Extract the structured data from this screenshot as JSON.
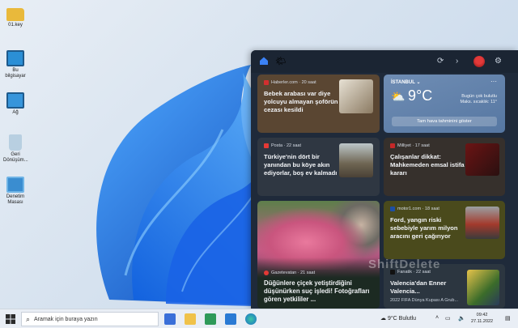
{
  "desktop": {
    "icons": [
      {
        "label": "01.key",
        "icon": "folder-icon",
        "color": "#e8b73a"
      },
      {
        "label": "Bu bilgisayar",
        "icon": "computer-icon",
        "color": "#2b8fd6"
      },
      {
        "label": "Ağ",
        "icon": "network-icon",
        "color": "#2b8fd6"
      },
      {
        "label": "Geri Dönüşüm...",
        "icon": "recycle-bin-icon",
        "color": "#7aa7c7"
      },
      {
        "label": "Denetim Masası",
        "icon": "control-panel-icon",
        "color": "#3a8dd0"
      }
    ]
  },
  "widgets": {
    "top_bar": {
      "home_icon": "home-icon",
      "weather_icon": "weather-icon",
      "refresh_icon": "refresh-icon",
      "next_icon": "chevron-right-icon",
      "settings_icon": "gear-icon"
    },
    "weather": {
      "city": "İSTANBUL",
      "temp": "9°C",
      "condition": "Bugün çok bulutlu",
      "max": "Maks. sıcaklık: 11°",
      "button": "Tam hava tahminini göster"
    },
    "cards": [
      {
        "source": "Haberler.com · 20 saat",
        "title": "Bebek arabası var diye yolcuyu almayan şoförün cezası kesildi",
        "favcolor": "#d32f2f"
      },
      {
        "source": "Posta · 22 saat",
        "title": "Türkiye'nin dört bir yanından bu köye akın ediyorlar, boş ev kalmadı",
        "favcolor": "#e53935"
      },
      {
        "source": "Milliyet · 17 saat",
        "title": "Çalışanlar dikkat: Mahkemeden emsal istifa kararı",
        "favcolor": "#c62828"
      },
      {
        "source": "Gazetevatan · 21 saat",
        "title": "Düğünlere çiçek yetiştirdiğini düşünürken suç işledi! Fotoğrafları gören yetkililer ...",
        "favcolor": "#e53935"
      },
      {
        "source": "motor1.com · 18 saat",
        "title": "Ford, yangın riski sebebiyle yarım milyon aracını geri çağırıyor",
        "favcolor": "#1e4fa3"
      },
      {
        "source": "Fanatik · 22 saat",
        "title": "Valencia'dan Enner Valencia...",
        "subtitle": "2022 FIFA Dünya Kupası A Grub...",
        "favcolor": "#1a1a1a"
      }
    ]
  },
  "taskbar": {
    "search_placeholder": "Aramak için buraya yazın",
    "weather": "9°C  Bulutlu",
    "time": "09:42",
    "date": "27.11.2022"
  },
  "watermark": "ShiftDelete"
}
